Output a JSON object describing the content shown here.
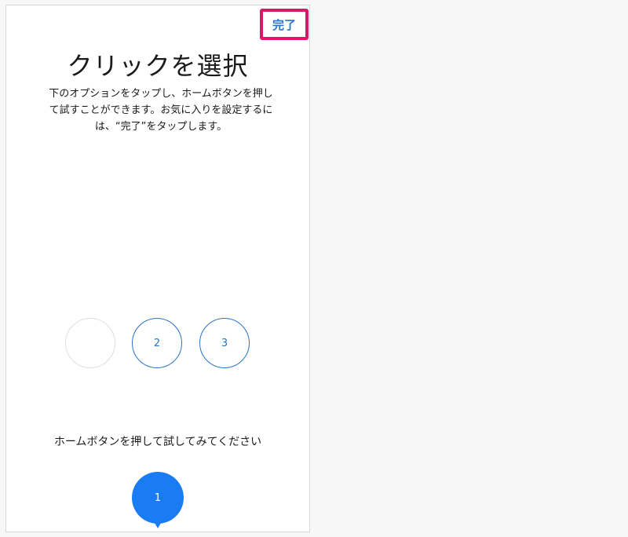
{
  "header": {
    "done_label": "完了"
  },
  "main": {
    "title": "クリックを選択",
    "description": "下のオプションをタップし、ホームボタンを押し\nて試すことができます。お気に入りを設定するに\nは、“完了”をタップします。",
    "options": [
      {
        "label": ""
      },
      {
        "label": "2"
      },
      {
        "label": "3"
      }
    ],
    "instruction": "ホームボタンを押して試してみてください",
    "indicator_label": "1"
  },
  "colors": {
    "accent": "#2a74c8",
    "highlight": "#e0156a",
    "indicator": "#1a7cf5"
  }
}
